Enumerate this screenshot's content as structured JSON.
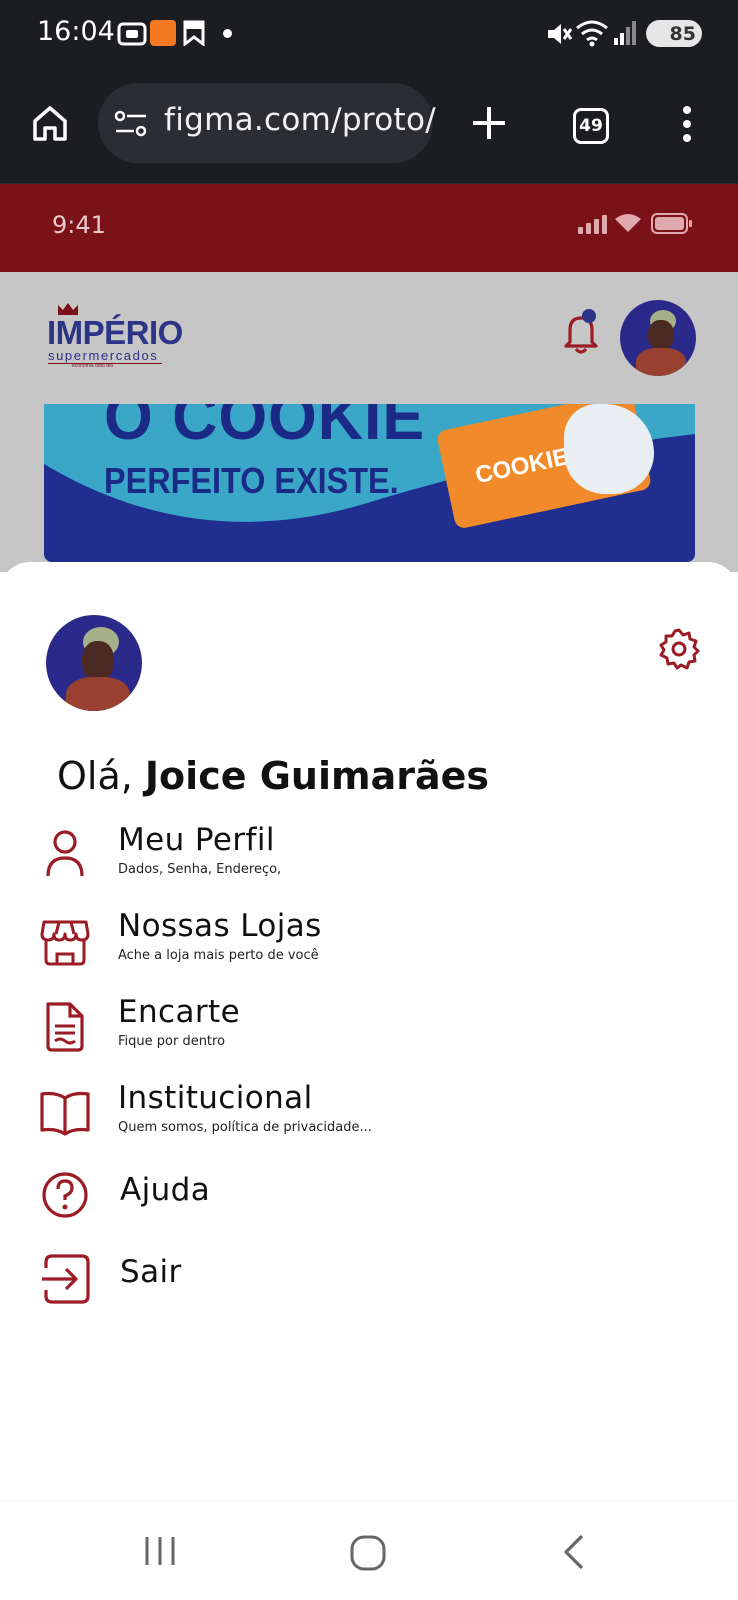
{
  "system": {
    "time": "16:04",
    "battery": "85"
  },
  "browser": {
    "url": "figma.com/proto/",
    "tab_count": "49"
  },
  "proto_status": {
    "time": "9:41"
  },
  "brand": {
    "name": "IMPÉRIO",
    "subtitle": "supermercados",
    "tagline": "economia todo dia"
  },
  "banner": {
    "line1": "O COOKIE",
    "line2": "PERFEITO EXISTE.",
    "package_label": "COOKIES"
  },
  "drawer": {
    "greeting_prefix": "Olá, ",
    "user_name": "Joice Guimarães",
    "menu": [
      {
        "title": "Meu Perfil",
        "subtitle": "Dados, Senha, Endereço,"
      },
      {
        "title": "Nossas Lojas",
        "subtitle": "Ache a loja mais perto de você"
      },
      {
        "title": "Encarte",
        "subtitle": "Fique por dentro"
      },
      {
        "title": "Institucional",
        "subtitle": "Quem somos, política de privacidade..."
      },
      {
        "title": "Ajuda",
        "subtitle": ""
      },
      {
        "title": "Sair",
        "subtitle": ""
      }
    ]
  },
  "colors": {
    "brand_red": "#9b1c24",
    "brand_blue": "#2b3486",
    "status_red": "#7b1219"
  }
}
